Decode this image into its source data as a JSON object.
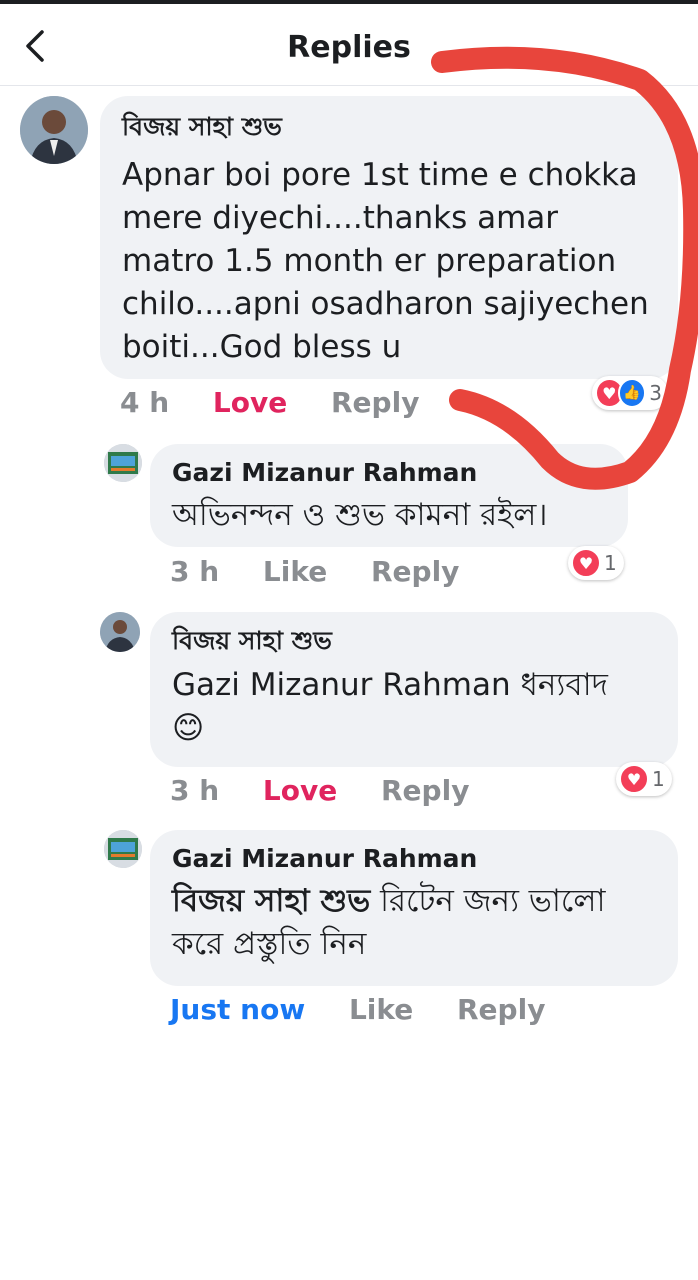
{
  "header": {
    "title": "Replies"
  },
  "comments": [
    {
      "author": "বিজয় সাহা শুভ",
      "text": "Apnar boi pore 1st time e chokka mere diyechi....thanks amar matro 1.5 month er preparation chilo....apni osadharon sajiyechen boiti...God bless u",
      "time": "4 h",
      "reaction_label": "Love",
      "reply_label": "Reply",
      "reaction_count": "3"
    },
    {
      "author": "Gazi Mizanur Rahman",
      "text": "অভিনন্দন ও শুভ কামনা রইল।",
      "time": "3 h",
      "reaction_label": "Like",
      "reply_label": "Reply",
      "reaction_count": "1"
    },
    {
      "author": "বিজয় সাহা শুভ",
      "text": "Gazi Mizanur Rahman ধন্যবাদ",
      "emoji": "😊",
      "time": "3 h",
      "reaction_label": "Love",
      "reply_label": "Reply",
      "reaction_count": "1"
    },
    {
      "author": "Gazi Mizanur Rahman",
      "mention": "বিজয় সাহা শুভ",
      "text": "রিটেন জন্য ভালো করে প্রস্তুতি নিন",
      "time": "Just now",
      "reaction_label": "Like",
      "reply_label": "Reply"
    }
  ],
  "colors": {
    "love": "#e0245e",
    "link": "#1877f2",
    "bubble": "#f0f2f5",
    "annotation": "#e8453c"
  }
}
